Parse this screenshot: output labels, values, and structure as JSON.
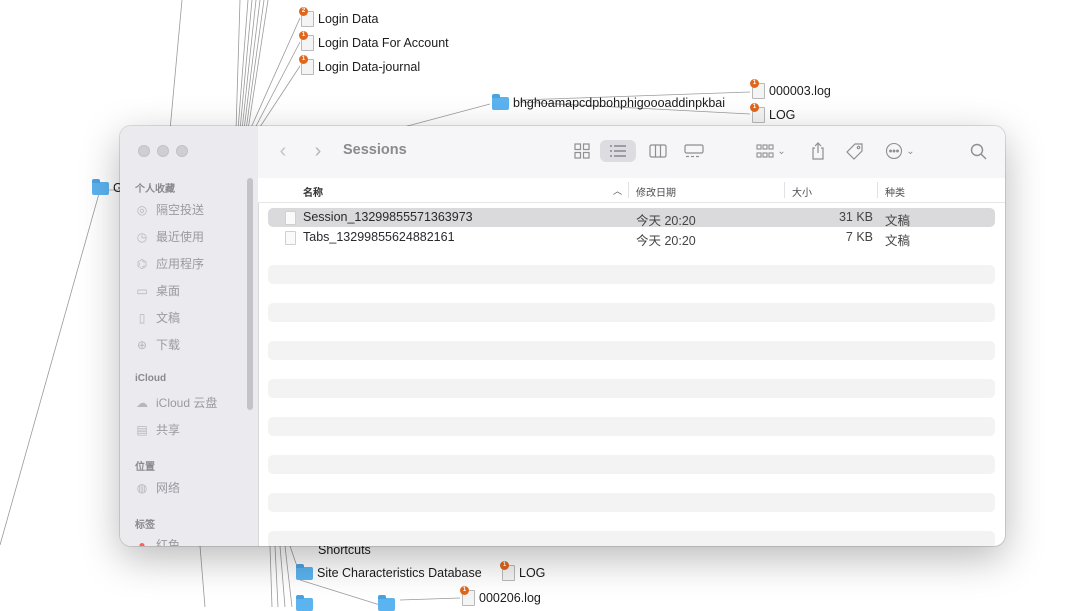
{
  "background_nodes": {
    "login_data": {
      "label": "Login Data",
      "badge": "2"
    },
    "login_data_account": {
      "label": "Login Data For Account",
      "badge": "1"
    },
    "login_data_journal": {
      "label": "Login Data-journal",
      "badge": "1"
    },
    "ext_folder": {
      "label": "bhghoamapcdpbohphigoooaddinpkbai"
    },
    "log_000003": {
      "label": "000003.log",
      "badge": "1"
    },
    "log_top": {
      "label": "LOG",
      "badge": "1"
    },
    "left_folder": {
      "label": "G"
    },
    "shortcuts": {
      "label": "Shortcuts"
    },
    "site_char_db": {
      "label": "Site Characteristics Database"
    },
    "log_bottom": {
      "label": "LOG",
      "badge": "1"
    },
    "log_000206": {
      "label": "000206.log",
      "badge": "1"
    }
  },
  "finder": {
    "title": "Sessions",
    "sidebar": {
      "favorites_header": "个人收藏",
      "favorites": [
        {
          "label": "隔空投送",
          "icon": "airdrop-icon"
        },
        {
          "label": "最近使用",
          "icon": "clock-icon"
        },
        {
          "label": "应用程序",
          "icon": "applications-icon"
        },
        {
          "label": "桌面",
          "icon": "desktop-icon"
        },
        {
          "label": "文稿",
          "icon": "document-icon"
        },
        {
          "label": "下载",
          "icon": "download-icon"
        }
      ],
      "icloud_header": "iCloud",
      "icloud": [
        {
          "label": "iCloud 云盘",
          "icon": "cloud-icon"
        },
        {
          "label": "共享",
          "icon": "shared-folder-icon"
        }
      ],
      "locations_header": "位置",
      "locations": [
        {
          "label": "网络",
          "icon": "globe-icon"
        }
      ],
      "tags_header": "标签",
      "tags": [
        {
          "label": "红色",
          "color": "#ff5f57"
        }
      ]
    },
    "columns": {
      "name": "名称",
      "modified": "修改日期",
      "size": "大小",
      "kind": "种类"
    },
    "files": [
      {
        "name": "Session_13299855571363973",
        "modified": "今天 20:20",
        "size": "31 KB",
        "kind": "文稿",
        "selected": true
      },
      {
        "name": "Tabs_13299855624882161",
        "modified": "今天 20:20",
        "size": "7 KB",
        "kind": "文稿",
        "selected": false
      }
    ]
  }
}
